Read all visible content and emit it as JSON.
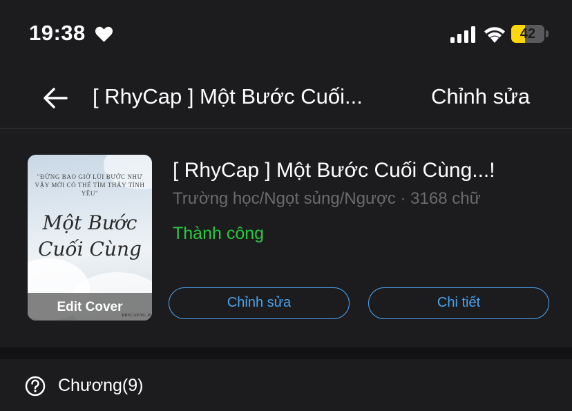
{
  "status_bar": {
    "time": "19:38",
    "battery_percent": 42,
    "battery_label": "42",
    "colors": {
      "battery_fill": "#ffd60a"
    },
    "icons": [
      "heart-icon",
      "signal-icon",
      "wifi-icon",
      "battery-icon"
    ]
  },
  "nav": {
    "title": "[ RhyCap ] Một Bước Cuối...",
    "edit_label": "Chỉnh sửa",
    "back_icon": "arrow-left-icon"
  },
  "story": {
    "cover": {
      "quote": "\"ĐỪNG BAO GIỜ LÙI BƯỚC NHƯ VẬY MỚI CÓ THỂ TÌM THẤY TÌNH YÊU\"",
      "title_line1": "Một Bước",
      "title_line2": "Cuối Cùng",
      "author": "RHYCAP NG. H",
      "edit_cover_label": "Edit Cover"
    },
    "title": "[ RhyCap ] Một Bước Cuối Cùng...!",
    "meta": "Trường học/Ngọt sủng/Ngược · 3168 chữ",
    "status": "Thành công",
    "edit_button": "Chỉnh sửa",
    "details_button": "Chi tiết",
    "colors": {
      "status": "#27c93f",
      "accent": "#4aa3f0"
    }
  },
  "chapters": {
    "label": "Chương(9)",
    "icon": "question-circle-icon"
  }
}
